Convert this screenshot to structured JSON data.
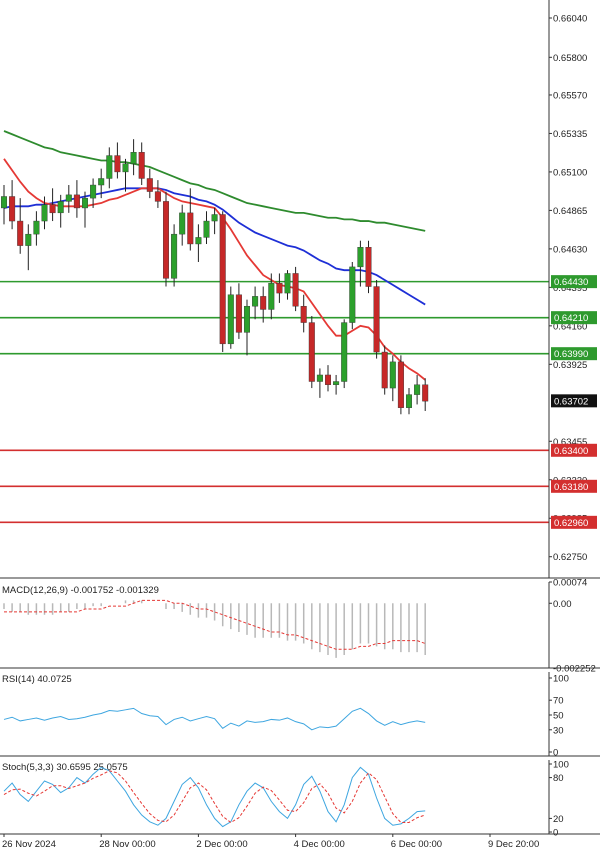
{
  "colors": {
    "bull": "#2ca02c",
    "bear": "#c62828",
    "wick": "#222222",
    "ma_fast": "#e53935",
    "ma_mid": "#1e2fd6",
    "ma_slow": "#2e8b2e",
    "support": "#d32f2f",
    "resistance": "#2e9a2e",
    "macd_signal": "#e53935",
    "macd_hist": "#b8b8b8",
    "rsi": "#3ea6e0",
    "stoch_k": "#3ea6e0",
    "stoch_d": "#e53935",
    "axis_text": "#222222",
    "grid": "#dddddd"
  },
  "chart_data": [
    {
      "type": "candlestick",
      "panel": "price",
      "ylim": [
        0.6262,
        0.6615
      ],
      "y_ticks": [
        "0.66040",
        "0.65800",
        "0.65570",
        "0.65335",
        "0.65100",
        "0.64865",
        "0.64630",
        "0.64395",
        "0.64160",
        "0.63925",
        "0.63455",
        "0.63220",
        "0.62985",
        "0.62750"
      ],
      "y_tick_values": [
        0.6604,
        0.658,
        0.6557,
        0.65335,
        0.651,
        0.64865,
        0.6463,
        0.64395,
        0.6416,
        0.63925,
        0.63455,
        0.6322,
        0.62985,
        0.6275
      ],
      "x_ticks": [
        "26 Nov 2024",
        "28 Nov 00:00",
        "2 Dec 00:00",
        "4 Dec 00:00",
        "6 Dec 00:00",
        "9 Dec 20:00"
      ],
      "x_tick_bars": [
        0,
        12,
        24,
        36,
        48,
        60
      ],
      "current_price": "0.63702",
      "current_price_value": 0.63702,
      "candles": [
        [
          0.6488,
          0.6502,
          0.6478,
          0.6495
        ],
        [
          0.6495,
          0.6505,
          0.6475,
          0.648
        ],
        [
          0.648,
          0.6494,
          0.646,
          0.6465
        ],
        [
          0.6465,
          0.6478,
          0.645,
          0.6472
        ],
        [
          0.6472,
          0.6486,
          0.6465,
          0.648
        ],
        [
          0.648,
          0.6495,
          0.6475,
          0.649
        ],
        [
          0.649,
          0.65,
          0.648,
          0.6485
        ],
        [
          0.6485,
          0.6496,
          0.6476,
          0.6492
        ],
        [
          0.6492,
          0.6502,
          0.6485,
          0.6496
        ],
        [
          0.6496,
          0.6505,
          0.6482,
          0.6488
        ],
        [
          0.6488,
          0.6498,
          0.6476,
          0.6494
        ],
        [
          0.6494,
          0.6506,
          0.6488,
          0.6502
        ],
        [
          0.6502,
          0.6512,
          0.6494,
          0.6506
        ],
        [
          0.6506,
          0.6525,
          0.65,
          0.652
        ],
        [
          0.652,
          0.6528,
          0.6506,
          0.651
        ],
        [
          0.651,
          0.6518,
          0.6498,
          0.6515
        ],
        [
          0.6515,
          0.653,
          0.6508,
          0.6522
        ],
        [
          0.6522,
          0.6528,
          0.6502,
          0.6506
        ],
        [
          0.6506,
          0.6512,
          0.6494,
          0.6498
        ],
        [
          0.6498,
          0.6505,
          0.6488,
          0.6492
        ],
        [
          0.6492,
          0.6498,
          0.644,
          0.6445
        ],
        [
          0.6445,
          0.6478,
          0.644,
          0.6472
        ],
        [
          0.6472,
          0.649,
          0.6465,
          0.6485
        ],
        [
          0.6485,
          0.65,
          0.6462,
          0.6466
        ],
        [
          0.6466,
          0.6478,
          0.6455,
          0.647
        ],
        [
          0.647,
          0.6486,
          0.6466,
          0.648
        ],
        [
          0.648,
          0.6488,
          0.6472,
          0.6484
        ],
        [
          0.6484,
          0.6486,
          0.64,
          0.6405
        ],
        [
          0.6405,
          0.644,
          0.6402,
          0.6435
        ],
        [
          0.6435,
          0.6442,
          0.6408,
          0.6412
        ],
        [
          0.6412,
          0.6432,
          0.6398,
          0.6428
        ],
        [
          0.6428,
          0.644,
          0.642,
          0.6434
        ],
        [
          0.6434,
          0.644,
          0.6418,
          0.6426
        ],
        [
          0.6426,
          0.6448,
          0.642,
          0.6442
        ],
        [
          0.6442,
          0.6448,
          0.643,
          0.6436
        ],
        [
          0.6436,
          0.645,
          0.6432,
          0.6448
        ],
        [
          0.6448,
          0.6452,
          0.6425,
          0.6428
        ],
        [
          0.6428,
          0.6435,
          0.6412,
          0.6418
        ],
        [
          0.6418,
          0.6422,
          0.6378,
          0.6382
        ],
        [
          0.6382,
          0.639,
          0.6372,
          0.6386
        ],
        [
          0.6386,
          0.6392,
          0.6376,
          0.638
        ],
        [
          0.638,
          0.6386,
          0.6374,
          0.6382
        ],
        [
          0.6382,
          0.642,
          0.6378,
          0.6418
        ],
        [
          0.6418,
          0.6455,
          0.6414,
          0.6452
        ],
        [
          0.6452,
          0.6468,
          0.644,
          0.6464
        ],
        [
          0.6464,
          0.6468,
          0.6436,
          0.644
        ],
        [
          0.644,
          0.6444,
          0.6396,
          0.64
        ],
        [
          0.64,
          0.6404,
          0.6374,
          0.6378
        ],
        [
          0.6378,
          0.6398,
          0.637,
          0.6394
        ],
        [
          0.6394,
          0.6398,
          0.6362,
          0.6366
        ],
        [
          0.6366,
          0.6378,
          0.6362,
          0.6374
        ],
        [
          0.6374,
          0.6386,
          0.6368,
          0.638
        ],
        [
          0.638,
          0.6384,
          0.6364,
          0.637
        ]
      ],
      "moving_averages": {
        "fast": [
          0.6518,
          0.6511,
          0.6504,
          0.6498,
          0.6494,
          0.6491,
          0.649,
          0.6489,
          0.6489,
          0.6489,
          0.6489,
          0.649,
          0.6491,
          0.6493,
          0.6494,
          0.6496,
          0.6498,
          0.65,
          0.65,
          0.65,
          0.6497,
          0.6494,
          0.6492,
          0.6491,
          0.649,
          0.6489,
          0.6488,
          0.6482,
          0.6475,
          0.6467,
          0.6459,
          0.6453,
          0.6447,
          0.6444,
          0.6441,
          0.644,
          0.6439,
          0.6437,
          0.643,
          0.6423,
          0.6416,
          0.641,
          0.641,
          0.6413,
          0.6416,
          0.6415,
          0.641,
          0.6403,
          0.6399,
          0.6394,
          0.639,
          0.6387,
          0.6383
        ],
        "mid": [
          0.6488,
          0.6489,
          0.6489,
          0.6489,
          0.649,
          0.649,
          0.6491,
          0.6492,
          0.6493,
          0.6494,
          0.6495,
          0.6496,
          0.6497,
          0.6498,
          0.6499,
          0.65,
          0.65,
          0.65,
          0.65,
          0.65,
          0.6499,
          0.6497,
          0.6496,
          0.6495,
          0.6493,
          0.6492,
          0.649,
          0.6487,
          0.6483,
          0.6479,
          0.6476,
          0.6473,
          0.6471,
          0.6469,
          0.6467,
          0.6465,
          0.6464,
          0.6462,
          0.6459,
          0.6456,
          0.6454,
          0.6451,
          0.645,
          0.645,
          0.645,
          0.6449,
          0.6447,
          0.6444,
          0.6441,
          0.6438,
          0.6435,
          0.6432,
          0.6429
        ],
        "slow": [
          0.6535,
          0.6533,
          0.6531,
          0.6529,
          0.6527,
          0.6525,
          0.6524,
          0.6522,
          0.6521,
          0.652,
          0.6519,
          0.6518,
          0.6517,
          0.6517,
          0.6516,
          0.6516,
          0.6515,
          0.6514,
          0.6513,
          0.6511,
          0.6509,
          0.6507,
          0.6505,
          0.6503,
          0.6502,
          0.65,
          0.6499,
          0.6497,
          0.6495,
          0.6493,
          0.6491,
          0.649,
          0.6489,
          0.6488,
          0.6487,
          0.6486,
          0.6485,
          0.6485,
          0.6484,
          0.6483,
          0.6482,
          0.6482,
          0.6481,
          0.6481,
          0.648,
          0.648,
          0.6479,
          0.6479,
          0.6478,
          0.6477,
          0.6476,
          0.6475,
          0.6474
        ]
      },
      "levels": [
        {
          "label": "0.64430",
          "value": 0.6443,
          "kind": "resistance"
        },
        {
          "label": "0.64210",
          "value": 0.6421,
          "kind": "resistance"
        },
        {
          "label": "0.63990",
          "value": 0.6399,
          "kind": "resistance"
        },
        {
          "label": "0.63400",
          "value": 0.634,
          "kind": "support"
        },
        {
          "label": "0.63180",
          "value": 0.6318,
          "kind": "support"
        },
        {
          "label": "0.62960",
          "value": 0.6296,
          "kind": "support"
        }
      ]
    },
    {
      "type": "histogram-line",
      "panel": "macd",
      "title": "MACD(12,26,9) -0.001752 -0.001329",
      "ylim": [
        -0.002252,
        0.00074
      ],
      "y_ticks": [
        "0.00074",
        "0.00",
        "-0.002252"
      ],
      "y_tick_values": [
        0.00074,
        0.0,
        -0.002252
      ],
      "histogram": [
        -0.0002,
        -0.0003,
        -0.0003,
        -0.0004,
        -0.0004,
        -0.0004,
        -0.0004,
        -0.0003,
        -0.0003,
        -0.0002,
        -0.0002,
        -0.0001,
        -0.0001,
        0.0,
        0.0,
        0.0001,
        0.0001,
        0.0001,
        0.0,
        0.0,
        -0.0002,
        -0.0002,
        -0.0003,
        -0.0004,
        -0.0005,
        -0.0005,
        -0.0006,
        -0.0008,
        -0.0009,
        -0.001,
        -0.0011,
        -0.0012,
        -0.0012,
        -0.0012,
        -0.0012,
        -0.0013,
        -0.0013,
        -0.0014,
        -0.0016,
        -0.0017,
        -0.0018,
        -0.0019,
        -0.0018,
        -0.0016,
        -0.0014,
        -0.0014,
        -0.0015,
        -0.0016,
        -0.0016,
        -0.0017,
        -0.0017,
        -0.0017,
        -0.0018
      ],
      "signal": [
        -0.0003,
        -0.0003,
        -0.0003,
        -0.0003,
        -0.0003,
        -0.0003,
        -0.0003,
        -0.0003,
        -0.0003,
        -0.0003,
        -0.0002,
        -0.0002,
        -0.0002,
        -0.0001,
        -0.0001,
        -0.0001,
        0.0,
        0.0001,
        0.0001,
        0.0001,
        0.0001,
        0.0,
        0.0,
        -0.0001,
        -0.0002,
        -0.0002,
        -0.0003,
        -0.0004,
        -0.0005,
        -0.0006,
        -0.0007,
        -0.0008,
        -0.0009,
        -0.001,
        -0.001,
        -0.0011,
        -0.0011,
        -0.0012,
        -0.0013,
        -0.0014,
        -0.0015,
        -0.0016,
        -0.0016,
        -0.0016,
        -0.0015,
        -0.0015,
        -0.0014,
        -0.0014,
        -0.0013,
        -0.0013,
        -0.0013,
        -0.0013,
        -0.0014
      ]
    },
    {
      "type": "line",
      "panel": "rsi",
      "title": "RSI(14) 40.0725",
      "ylim": [
        0,
        100
      ],
      "y_ticks": [
        "100",
        "70",
        "50",
        "30",
        "0"
      ],
      "y_tick_values": [
        100,
        70,
        50,
        30,
        0
      ],
      "values": [
        44,
        47,
        42,
        44,
        46,
        43,
        46,
        48,
        44,
        45,
        47,
        50,
        52,
        56,
        55,
        57,
        59,
        52,
        49,
        48,
        37,
        44,
        47,
        42,
        45,
        48,
        45,
        32,
        39,
        35,
        42,
        40,
        41,
        44,
        43,
        46,
        41,
        38,
        30,
        34,
        33,
        35,
        45,
        55,
        59,
        52,
        42,
        36,
        41,
        37,
        40,
        42,
        40
      ]
    },
    {
      "type": "line",
      "panel": "stoch",
      "title": "Stoch(5,3,3) 30.6595 25.0575",
      "ylim": [
        0,
        100
      ],
      "y_ticks": [
        "100",
        "80",
        "20",
        "0"
      ],
      "y_tick_values": [
        100,
        80,
        20,
        0
      ],
      "k": [
        60,
        72,
        55,
        45,
        60,
        75,
        70,
        58,
        65,
        80,
        72,
        85,
        95,
        90,
        75,
        60,
        40,
        25,
        15,
        10,
        20,
        45,
        70,
        80,
        65,
        40,
        20,
        8,
        15,
        40,
        60,
        72,
        65,
        45,
        30,
        20,
        40,
        70,
        82,
        60,
        30,
        15,
        40,
        80,
        95,
        85,
        50,
        20,
        10,
        12,
        20,
        30,
        31
      ],
      "d": [
        55,
        62,
        63,
        57,
        53,
        60,
        68,
        68,
        64,
        68,
        72,
        79,
        84,
        90,
        87,
        75,
        58,
        42,
        27,
        17,
        15,
        25,
        45,
        65,
        72,
        62,
        42,
        23,
        14,
        21,
        38,
        57,
        66,
        61,
        47,
        32,
        30,
        43,
        64,
        71,
        57,
        35,
        28,
        45,
        72,
        87,
        77,
        52,
        27,
        14,
        14,
        21,
        25
      ]
    }
  ]
}
